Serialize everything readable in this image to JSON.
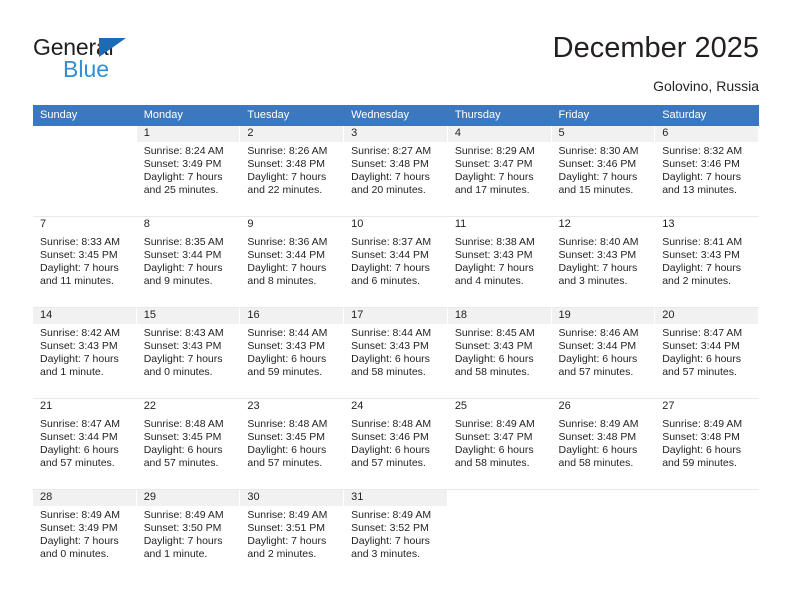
{
  "brand": {
    "name_part1": "General",
    "name_part2": "Blue",
    "triangle_color": "#1b6cb5",
    "blue_text_color": "#2e8fd8"
  },
  "header": {
    "title": "December 2025",
    "subtitle": "Golovino, Russia"
  },
  "theme": {
    "header_row_background": "#3b78bf",
    "header_row_text": "#ffffff",
    "day_number_strip": "#f1f1f1",
    "page_background": "#ffffff",
    "body_text": "#231f20"
  },
  "weekday_headers": [
    "Sunday",
    "Monday",
    "Tuesday",
    "Wednesday",
    "Thursday",
    "Friday",
    "Saturday"
  ],
  "weeks": [
    {
      "shaded": true,
      "days": [
        {
          "empty": true
        },
        {
          "date": "1",
          "sunrise": "Sunrise: 8:24 AM",
          "sunset": "Sunset: 3:49 PM",
          "daylight_line1": "Daylight: 7 hours",
          "daylight_line2": "and 25 minutes."
        },
        {
          "date": "2",
          "sunrise": "Sunrise: 8:26 AM",
          "sunset": "Sunset: 3:48 PM",
          "daylight_line1": "Daylight: 7 hours",
          "daylight_line2": "and 22 minutes."
        },
        {
          "date": "3",
          "sunrise": "Sunrise: 8:27 AM",
          "sunset": "Sunset: 3:48 PM",
          "daylight_line1": "Daylight: 7 hours",
          "daylight_line2": "and 20 minutes."
        },
        {
          "date": "4",
          "sunrise": "Sunrise: 8:29 AM",
          "sunset": "Sunset: 3:47 PM",
          "daylight_line1": "Daylight: 7 hours",
          "daylight_line2": "and 17 minutes."
        },
        {
          "date": "5",
          "sunrise": "Sunrise: 8:30 AM",
          "sunset": "Sunset: 3:46 PM",
          "daylight_line1": "Daylight: 7 hours",
          "daylight_line2": "and 15 minutes."
        },
        {
          "date": "6",
          "sunrise": "Sunrise: 8:32 AM",
          "sunset": "Sunset: 3:46 PM",
          "daylight_line1": "Daylight: 7 hours",
          "daylight_line2": "and 13 minutes."
        }
      ]
    },
    {
      "shaded": false,
      "days": [
        {
          "date": "7",
          "sunrise": "Sunrise: 8:33 AM",
          "sunset": "Sunset: 3:45 PM",
          "daylight_line1": "Daylight: 7 hours",
          "daylight_line2": "and 11 minutes."
        },
        {
          "date": "8",
          "sunrise": "Sunrise: 8:35 AM",
          "sunset": "Sunset: 3:44 PM",
          "daylight_line1": "Daylight: 7 hours",
          "daylight_line2": "and 9 minutes."
        },
        {
          "date": "9",
          "sunrise": "Sunrise: 8:36 AM",
          "sunset": "Sunset: 3:44 PM",
          "daylight_line1": "Daylight: 7 hours",
          "daylight_line2": "and 8 minutes."
        },
        {
          "date": "10",
          "sunrise": "Sunrise: 8:37 AM",
          "sunset": "Sunset: 3:44 PM",
          "daylight_line1": "Daylight: 7 hours",
          "daylight_line2": "and 6 minutes."
        },
        {
          "date": "11",
          "sunrise": "Sunrise: 8:38 AM",
          "sunset": "Sunset: 3:43 PM",
          "daylight_line1": "Daylight: 7 hours",
          "daylight_line2": "and 4 minutes."
        },
        {
          "date": "12",
          "sunrise": "Sunrise: 8:40 AM",
          "sunset": "Sunset: 3:43 PM",
          "daylight_line1": "Daylight: 7 hours",
          "daylight_line2": "and 3 minutes."
        },
        {
          "date": "13",
          "sunrise": "Sunrise: 8:41 AM",
          "sunset": "Sunset: 3:43 PM",
          "daylight_line1": "Daylight: 7 hours",
          "daylight_line2": "and 2 minutes."
        }
      ]
    },
    {
      "shaded": true,
      "days": [
        {
          "date": "14",
          "sunrise": "Sunrise: 8:42 AM",
          "sunset": "Sunset: 3:43 PM",
          "daylight_line1": "Daylight: 7 hours",
          "daylight_line2": "and 1 minute."
        },
        {
          "date": "15",
          "sunrise": "Sunrise: 8:43 AM",
          "sunset": "Sunset: 3:43 PM",
          "daylight_line1": "Daylight: 7 hours",
          "daylight_line2": "and 0 minutes."
        },
        {
          "date": "16",
          "sunrise": "Sunrise: 8:44 AM",
          "sunset": "Sunset: 3:43 PM",
          "daylight_line1": "Daylight: 6 hours",
          "daylight_line2": "and 59 minutes."
        },
        {
          "date": "17",
          "sunrise": "Sunrise: 8:44 AM",
          "sunset": "Sunset: 3:43 PM",
          "daylight_line1": "Daylight: 6 hours",
          "daylight_line2": "and 58 minutes."
        },
        {
          "date": "18",
          "sunrise": "Sunrise: 8:45 AM",
          "sunset": "Sunset: 3:43 PM",
          "daylight_line1": "Daylight: 6 hours",
          "daylight_line2": "and 58 minutes."
        },
        {
          "date": "19",
          "sunrise": "Sunrise: 8:46 AM",
          "sunset": "Sunset: 3:44 PM",
          "daylight_line1": "Daylight: 6 hours",
          "daylight_line2": "and 57 minutes."
        },
        {
          "date": "20",
          "sunrise": "Sunrise: 8:47 AM",
          "sunset": "Sunset: 3:44 PM",
          "daylight_line1": "Daylight: 6 hours",
          "daylight_line2": "and 57 minutes."
        }
      ]
    },
    {
      "shaded": false,
      "days": [
        {
          "date": "21",
          "sunrise": "Sunrise: 8:47 AM",
          "sunset": "Sunset: 3:44 PM",
          "daylight_line1": "Daylight: 6 hours",
          "daylight_line2": "and 57 minutes."
        },
        {
          "date": "22",
          "sunrise": "Sunrise: 8:48 AM",
          "sunset": "Sunset: 3:45 PM",
          "daylight_line1": "Daylight: 6 hours",
          "daylight_line2": "and 57 minutes."
        },
        {
          "date": "23",
          "sunrise": "Sunrise: 8:48 AM",
          "sunset": "Sunset: 3:45 PM",
          "daylight_line1": "Daylight: 6 hours",
          "daylight_line2": "and 57 minutes."
        },
        {
          "date": "24",
          "sunrise": "Sunrise: 8:48 AM",
          "sunset": "Sunset: 3:46 PM",
          "daylight_line1": "Daylight: 6 hours",
          "daylight_line2": "and 57 minutes."
        },
        {
          "date": "25",
          "sunrise": "Sunrise: 8:49 AM",
          "sunset": "Sunset: 3:47 PM",
          "daylight_line1": "Daylight: 6 hours",
          "daylight_line2": "and 58 minutes."
        },
        {
          "date": "26",
          "sunrise": "Sunrise: 8:49 AM",
          "sunset": "Sunset: 3:48 PM",
          "daylight_line1": "Daylight: 6 hours",
          "daylight_line2": "and 58 minutes."
        },
        {
          "date": "27",
          "sunrise": "Sunrise: 8:49 AM",
          "sunset": "Sunset: 3:48 PM",
          "daylight_line1": "Daylight: 6 hours",
          "daylight_line2": "and 59 minutes."
        }
      ]
    },
    {
      "shaded": true,
      "days": [
        {
          "date": "28",
          "sunrise": "Sunrise: 8:49 AM",
          "sunset": "Sunset: 3:49 PM",
          "daylight_line1": "Daylight: 7 hours",
          "daylight_line2": "and 0 minutes."
        },
        {
          "date": "29",
          "sunrise": "Sunrise: 8:49 AM",
          "sunset": "Sunset: 3:50 PM",
          "daylight_line1": "Daylight: 7 hours",
          "daylight_line2": "and 1 minute."
        },
        {
          "date": "30",
          "sunrise": "Sunrise: 8:49 AM",
          "sunset": "Sunset: 3:51 PM",
          "daylight_line1": "Daylight: 7 hours",
          "daylight_line2": "and 2 minutes."
        },
        {
          "date": "31",
          "sunrise": "Sunrise: 8:49 AM",
          "sunset": "Sunset: 3:52 PM",
          "daylight_line1": "Daylight: 7 hours",
          "daylight_line2": "and 3 minutes."
        },
        {
          "empty": true
        },
        {
          "empty": true
        },
        {
          "empty": true
        }
      ]
    }
  ]
}
